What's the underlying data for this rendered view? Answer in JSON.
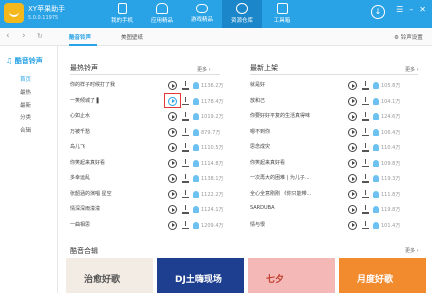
{
  "app": {
    "name": "XY苹果助手",
    "version": "5.0.0.11975"
  },
  "nav": [
    {
      "label": "我的手机",
      "icon": "phone-icon",
      "active": false
    },
    {
      "label": "应用精品",
      "icon": "app-store-icon",
      "active": false
    },
    {
      "label": "游戏精品",
      "icon": "gamepad-icon",
      "active": false
    },
    {
      "label": "资源仓库",
      "icon": "music-library-icon",
      "active": true
    },
    {
      "label": "工具箱",
      "icon": "toolbox-icon",
      "active": false
    }
  ],
  "tabs": [
    {
      "label": "酷音铃声",
      "active": true
    },
    {
      "label": "美图壁纸",
      "active": false
    }
  ],
  "settings_label": "铃声设置",
  "sidebar": {
    "title": "酷音铃声",
    "items": [
      "首页",
      "最热",
      "最新",
      "分类",
      "合辑"
    ],
    "active_index": 0
  },
  "hot": {
    "title": "最热铃声",
    "more": "更多",
    "items": [
      {
        "title": "你的样子时候打了我",
        "sub": "",
        "count": "1136.2万"
      },
      {
        "title": "一笑倾城了 ▌",
        "sub": "",
        "count": "1178.4万"
      },
      {
        "title": "心如止水",
        "sub": "",
        "count": "1019.2万"
      },
      {
        "title": "万被千愁",
        "sub": "",
        "count": "879.7万"
      },
      {
        "title": "岛儿飞",
        "sub": "",
        "count": "1110.5万"
      },
      {
        "title": "你笑起来真好看",
        "sub": "",
        "count": "1114.8万"
      },
      {
        "title": "多幸运乱",
        "sub": "",
        "count": "1138.1万"
      },
      {
        "title": "张韶涵的演唱 星空",
        "sub": "",
        "count": "1122.2万"
      },
      {
        "title": "情深深雨濛濛",
        "sub": "",
        "count": "1124.1万"
      },
      {
        "title": "一曲相思",
        "sub": "",
        "count": "1209.4万"
      }
    ]
  },
  "latest": {
    "title": "最新上架",
    "more": "更多",
    "items": [
      {
        "title": "就是好",
        "sub": "",
        "count": "105.8万"
      },
      {
        "title": "放和己",
        "sub": "",
        "count": "104.1万"
      },
      {
        "title": "你要好好平复的生活真得味",
        "sub": "",
        "count": "124.6万"
      },
      {
        "title": "嗯不到你",
        "sub": "",
        "count": "106.4万"
      },
      {
        "title": "思念成灾",
        "sub": "",
        "count": "110.4万"
      },
      {
        "title": "你笑起来真好看",
        "sub": "",
        "count": "109.8万"
      },
      {
        "title": "一次再大的困难 | 为儿子...",
        "sub": "",
        "count": "119.3万"
      },
      {
        "title": "全心全意刚刚 《你只能带...",
        "sub": "",
        "count": "111.8万"
      },
      {
        "title": "SARDUBA",
        "sub": "",
        "count": "119.8万"
      },
      {
        "title": "情与恨",
        "sub": "",
        "count": "101.4万"
      }
    ]
  },
  "albums": {
    "title": "酷音合辑",
    "more": "更多",
    "items": [
      {
        "label": "治愈好歌",
        "bg": "#f3ece4",
        "color": "#555"
      },
      {
        "label": "DJ土嗨现场",
        "bg": "#1e3f8f",
        "color": "#ffffff"
      },
      {
        "label": "七夕",
        "bg": "#f4b9b6",
        "color": "#c0392b"
      },
      {
        "label": "月度好歌",
        "bg": "#f28a2e",
        "color": "#ffffff"
      }
    ]
  },
  "colors": {
    "accent": "#2aa3e6",
    "highlight_box": "#e53935"
  }
}
